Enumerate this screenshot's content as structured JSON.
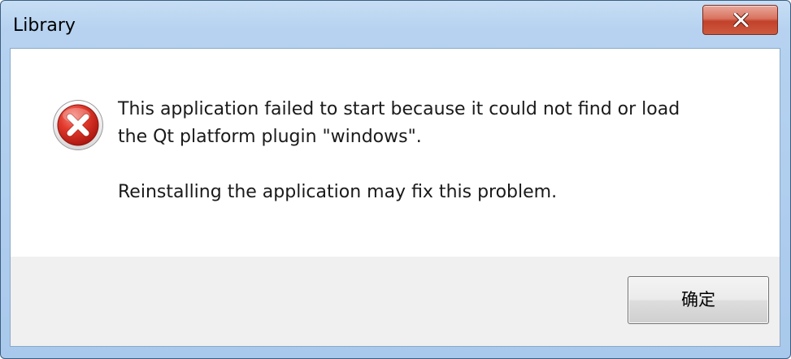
{
  "window": {
    "title": "Library"
  },
  "titlebar": {
    "close_icon": "close-icon"
  },
  "message": {
    "icon": "error-icon",
    "line1": "This application failed to start because it could not find or load",
    "line2": "the Qt platform plugin \"windows\".",
    "line3": "Reinstalling the application may fix this problem."
  },
  "buttons": {
    "ok_label": "确定"
  },
  "colors": {
    "titlebar": "#b6d2f0",
    "close_button": "#c2412a",
    "error_icon": "#d0241b",
    "footer": "#f0f0f0"
  }
}
